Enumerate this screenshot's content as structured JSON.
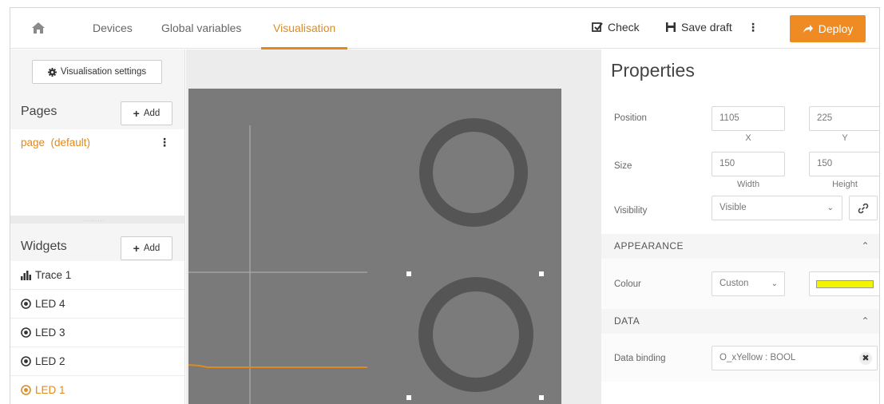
{
  "topbar": {
    "home_icon": "home-icon",
    "tabs": [
      {
        "label": "Devices"
      },
      {
        "label": "Global variables"
      },
      {
        "label": "Visualisation",
        "active": true
      }
    ],
    "check_label": "Check",
    "save_label": "Save draft",
    "more_label": "⋮",
    "deploy_label": "Deploy",
    "accent_color": "#ee8b22"
  },
  "left": {
    "settings_label": "Visualisation settings",
    "pages_title": "Pages",
    "pages_add": "Add",
    "pages": [
      {
        "label": "page  (default)"
      }
    ],
    "page_menu": "⋮",
    "widgets_title": "Widgets",
    "widgets_add": "Add",
    "widgets": [
      {
        "label": "Trace 1",
        "icon": "bar-chart-icon"
      },
      {
        "label": "LED 4",
        "icon": "led-icon"
      },
      {
        "label": "LED 3",
        "icon": "led-icon"
      },
      {
        "label": "LED 2",
        "icon": "led-icon"
      },
      {
        "label": "LED 1",
        "icon": "led-icon",
        "active": true
      }
    ]
  },
  "properties": {
    "title": "Properties",
    "position_label": "Position",
    "x_value": "1105",
    "y_value": "225",
    "x_caption": "X",
    "y_caption": "Y",
    "size_label": "Size",
    "width_value": "150",
    "height_value": "150",
    "width_caption": "Width",
    "height_caption": "Height",
    "visibility_label": "Visibility",
    "visibility_value": "Visible",
    "appearance_header": "APPEARANCE",
    "colour_label": "Colour",
    "colour_value": "Custon",
    "colour_swatch": "#f4f400",
    "data_header": "DATA",
    "binding_label": "Data binding",
    "binding_value": "O_xYellow : BOOL"
  }
}
